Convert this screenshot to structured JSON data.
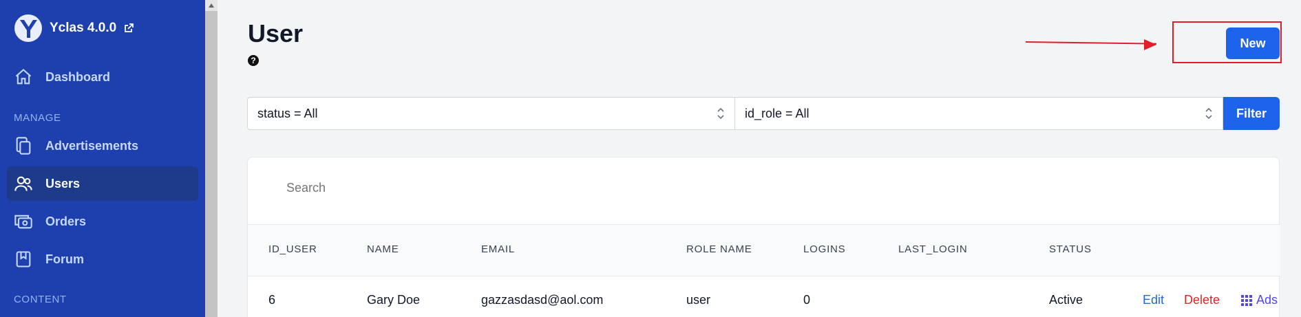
{
  "brand": {
    "title": "Yclas 4.0.0"
  },
  "nav": {
    "dashboard": "Dashboard",
    "manage_label": "MANAGE",
    "advertisements": "Advertisements",
    "users": "Users",
    "orders": "Orders",
    "forum": "Forum",
    "content_label": "CONTENT"
  },
  "header": {
    "title": "User",
    "help": "?",
    "new_label": "New"
  },
  "filters": {
    "status": "status = All",
    "id_role": "id_role = All",
    "filter_label": "Filter"
  },
  "search": {
    "placeholder": "Search"
  },
  "table": {
    "headers": [
      "ID_USER",
      "NAME",
      "EMAIL",
      "ROLE NAME",
      "LOGINS",
      "LAST_LOGIN",
      "STATUS"
    ],
    "rows": [
      {
        "id": "6",
        "name": "Gary Doe",
        "email": "gazzasdasd@aol.com",
        "role": "user",
        "logins": "0",
        "last_login": "",
        "status": "Active"
      }
    ],
    "actions": {
      "edit": "Edit",
      "delete": "Delete",
      "ads": "Ads"
    }
  },
  "colors": {
    "sidebar": "#1e40af",
    "primary": "#1d63ec",
    "annotation": "#e11d2a"
  }
}
